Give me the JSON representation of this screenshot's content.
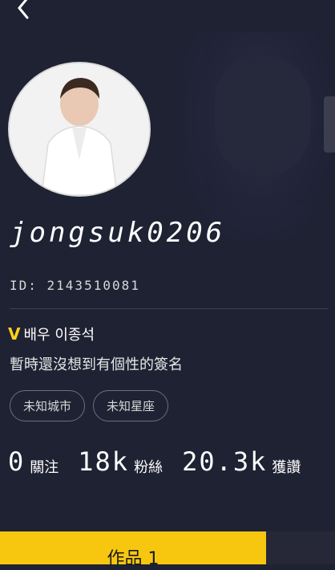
{
  "profile": {
    "username": "jongsuk0206",
    "id_label": "ID: 2143510081",
    "verified_mark": "V",
    "verified_text": "배우 이종석",
    "signature": "暫時還沒想到有個性的簽名",
    "tags": [
      "未知城市",
      "未知星座"
    ]
  },
  "stats": [
    {
      "value": "0",
      "label": "關注"
    },
    {
      "value": "18k",
      "label": "粉絲"
    },
    {
      "value": "20.3k",
      "label": "獲讚"
    }
  ],
  "bottom_tab": {
    "label": "作品 1"
  },
  "colors": {
    "background": "#1f2233",
    "accent": "#f7c710",
    "verified": "#ffd21a"
  },
  "icons": {
    "back": "chevron-left-icon",
    "verified": "v-verified-icon"
  }
}
